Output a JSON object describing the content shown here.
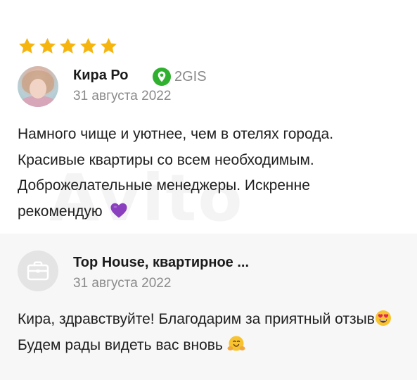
{
  "review": {
    "rating": 5,
    "rating_max": 5,
    "star_color": "#f6b40f",
    "author_name": "Кира Ро",
    "source_label": "2GIS",
    "source_color": "#2fb02f",
    "date": "31 августа 2022",
    "text": "Намного чище и уютнее, чем в отелях города. Красивые квартиры со всем необходимым. Доброжелательные менеджеры. Искренне рекомендую",
    "text_emoji": "purple-heart"
  },
  "reply": {
    "author_name": "Top House, квартирное ...",
    "date": "31 августа 2022",
    "text_part1": "Кира, здравствуйте! Благодарим за приятный отзыв",
    "emoji1": "heart-eyes",
    "text_part2": " Будем рады видеть вас вновь ",
    "emoji2": "hugging-face"
  },
  "watermark": "Avito"
}
